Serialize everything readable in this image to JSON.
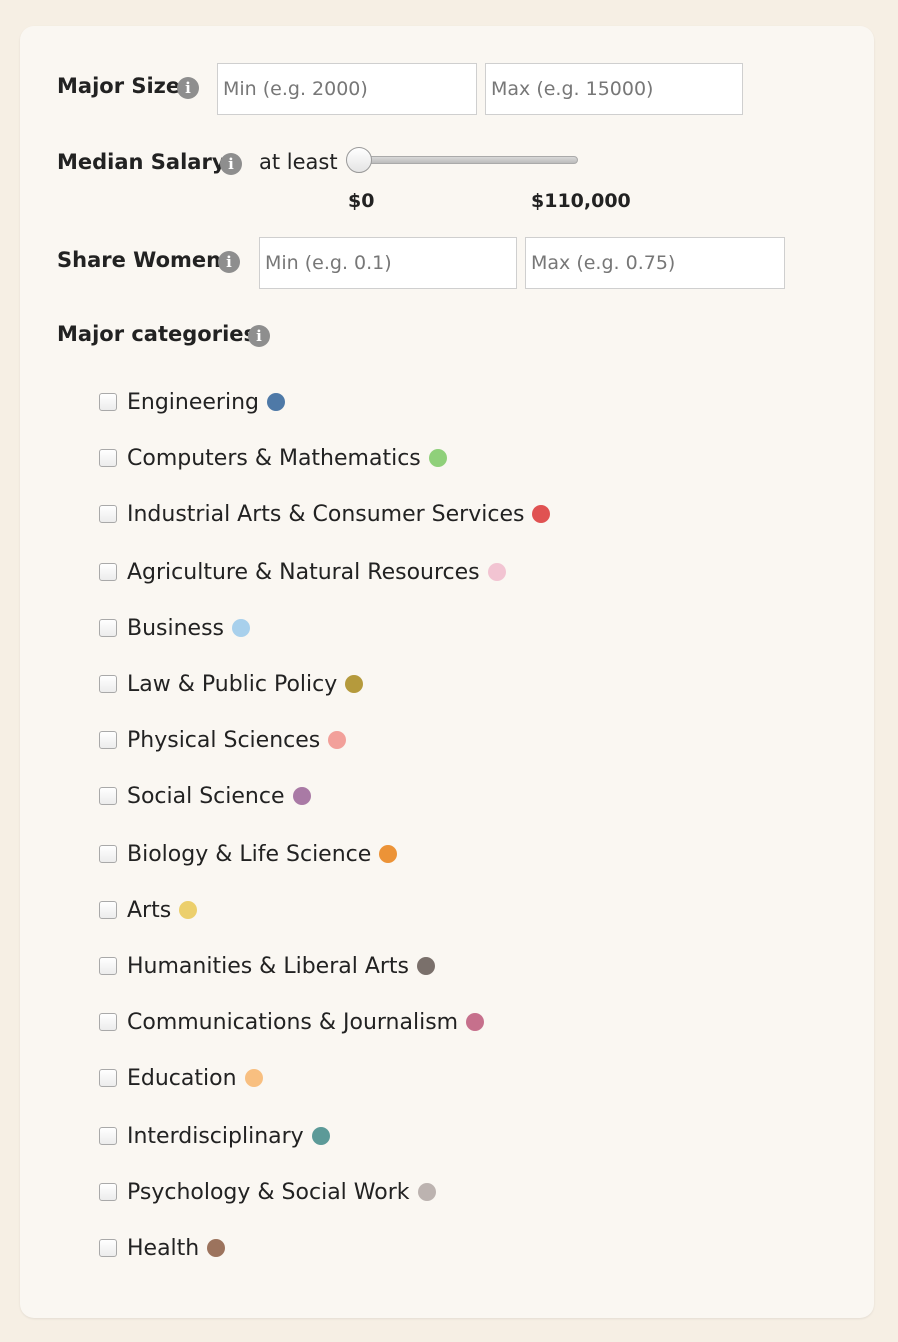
{
  "filters": {
    "major_size": {
      "label": "Major Size",
      "min_placeholder": "Min (e.g. 2000)",
      "max_placeholder": "Max (e.g. 15000)"
    },
    "median_salary": {
      "label": "Median Salary",
      "prefix": "at least",
      "min_tick": "$0",
      "max_tick": "$110,000",
      "slider_fraction": 0
    },
    "share_women": {
      "label": "Share Women",
      "min_placeholder": "Min (e.g. 0.1)",
      "max_placeholder": "Max (e.g. 0.75)"
    },
    "info_icon": "i"
  },
  "categories_heading": "Major categories",
  "categories": [
    {
      "label": "Engineering",
      "color": "#4e79a7"
    },
    {
      "label": "Computers & Mathematics",
      "color": "#8fd07a"
    },
    {
      "label": "Industrial Arts & Consumer Services",
      "color": "#e05252"
    },
    {
      "label": "Agriculture & Natural Resources",
      "color": "#f2c4d2"
    },
    {
      "label": "Business",
      "color": "#a8d0ec"
    },
    {
      "label": "Law & Public Policy",
      "color": "#b59a3c"
    },
    {
      "label": "Physical Sciences",
      "color": "#f2a09a"
    },
    {
      "label": "Social Science",
      "color": "#a97aa5"
    },
    {
      "label": "Biology & Life Science",
      "color": "#ec9337"
    },
    {
      "label": "Arts",
      "color": "#eccf6c"
    },
    {
      "label": "Humanities & Liberal Arts",
      "color": "#7a706b"
    },
    {
      "label": "Communications & Journalism",
      "color": "#c6708c"
    },
    {
      "label": "Education",
      "color": "#f8bf80"
    },
    {
      "label": "Interdisciplinary",
      "color": "#5c9a98"
    },
    {
      "label": "Psychology & Social Work",
      "color": "#bcb3b0"
    },
    {
      "label": "Health",
      "color": "#9c735d"
    }
  ]
}
